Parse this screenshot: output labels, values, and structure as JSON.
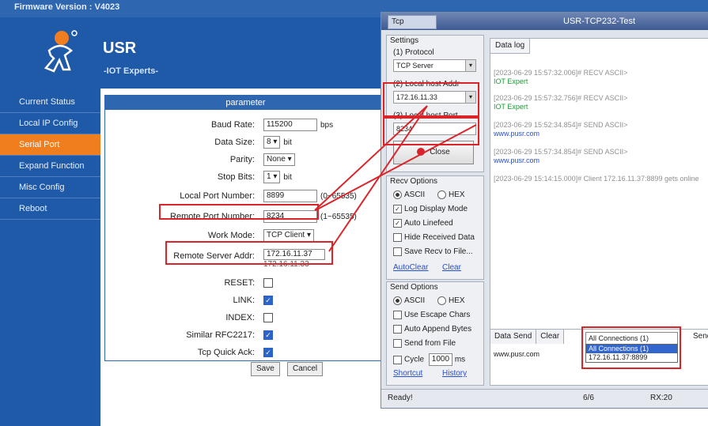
{
  "web": {
    "header_title": "Firmware Version : V4023",
    "brand": "USR",
    "tagline": "-IOT Experts-",
    "nav": [
      {
        "label": "Current Status",
        "active": false
      },
      {
        "label": "Local IP Config",
        "active": false
      },
      {
        "label": "Serial Port",
        "active": true
      },
      {
        "label": "Expand Function",
        "active": false
      },
      {
        "label": "Misc Config",
        "active": false
      },
      {
        "label": "Reboot",
        "active": false
      }
    ],
    "panel_title": "parameter",
    "fields": {
      "baud_rate": {
        "label": "Baud Rate:",
        "value": "115200",
        "unit": "bps"
      },
      "data_size": {
        "label": "Data Size:",
        "value": "8",
        "unit": "bit"
      },
      "parity": {
        "label": "Parity:",
        "value": "None"
      },
      "stop_bits": {
        "label": "Stop Bits:",
        "value": "1",
        "unit": "bit"
      },
      "local_port": {
        "label": "Local Port Number:",
        "value": "8899",
        "range": "(0~65535)"
      },
      "remote_port": {
        "label": "Remote Port Number:",
        "value": "8234",
        "range": "(1~65535)"
      },
      "work_mode": {
        "label": "Work Mode:",
        "value": "TCP Client"
      },
      "remote_server": {
        "label": "Remote Server Addr:",
        "value": "172.16.11.37",
        "value2": "172.16.11.33"
      },
      "reset": {
        "label": "RESET:",
        "checked": false
      },
      "link": {
        "label": "LINK:",
        "checked": true
      },
      "index": {
        "label": "INDEX:",
        "checked": false
      },
      "rfc2217": {
        "label": "Similar RFC2217:",
        "checked": true
      },
      "quick_ack": {
        "label": "Tcp Quick Ack:",
        "checked": true
      }
    },
    "save_label": "Save",
    "cancel_label": "Cancel"
  },
  "tool": {
    "title": "USR-TCP232-Test",
    "tab_label": "Tcp",
    "settings": {
      "title": "Settings",
      "protocol_label": "(1) Protocol",
      "protocol_value": "TCP Server",
      "local_host_label": "(2) Local host Addr",
      "local_host_value": "172.16.11.33",
      "local_port_label": "(3) Local host Port",
      "local_port_value": "8234",
      "close_label": "Close"
    },
    "recv_options": {
      "title": "Recv Options",
      "ascii": "ASCII",
      "hex": "HEX",
      "log_display": "Log Display Mode",
      "auto_linefeed": "Auto Linefeed",
      "hide_received": "Hide Received Data",
      "save_recv": "Save Recv to File...",
      "autoclear": "AutoClear",
      "clear": "Clear"
    },
    "send_options": {
      "title": "Send Options",
      "ascii": "ASCII",
      "hex": "HEX",
      "escape": "Use Escape Chars",
      "auto_append": "Auto Append Bytes",
      "send_from_file": "Send from File",
      "cycle": "Cycle",
      "cycle_value": "1000",
      "cycle_unit": "ms",
      "shortcut": "Shortcut",
      "history": "History"
    },
    "log": {
      "tab": "Data log",
      "entries": [
        {
          "ts": "[2023-06-29 15:57:32.006]# RECV ASCII>",
          "msg": "IOT Expert",
          "send": false
        },
        {
          "ts": "[2023-06-29 15:57:32.756]# RECV ASCII>",
          "msg": "IOT Expert",
          "send": false
        },
        {
          "ts": "[2023-06-29 15:52:34.854]# SEND ASCII>",
          "msg": "www.pusr.com",
          "send": true
        },
        {
          "ts": "[2023-06-29 15:57:34.854]# SEND ASCII>",
          "msg": "www.pusr.com",
          "send": true
        },
        {
          "ts": "[2023-06-29 15:14:15.000]# Client 172.16.11.37:8899 gets online",
          "msg": "",
          "send": false
        }
      ]
    },
    "send": {
      "tab_send": "Data Send",
      "tab_clear": "Clear",
      "connections": "All Connections (1)",
      "dropdown": [
        "All Connections (1)",
        "172.16.11.37:8899"
      ],
      "text": "www.pusr.com",
      "send_btn": "Send"
    },
    "status": {
      "ready": "Ready!",
      "send_count": "6/6",
      "recv_count": "RX:20"
    }
  }
}
